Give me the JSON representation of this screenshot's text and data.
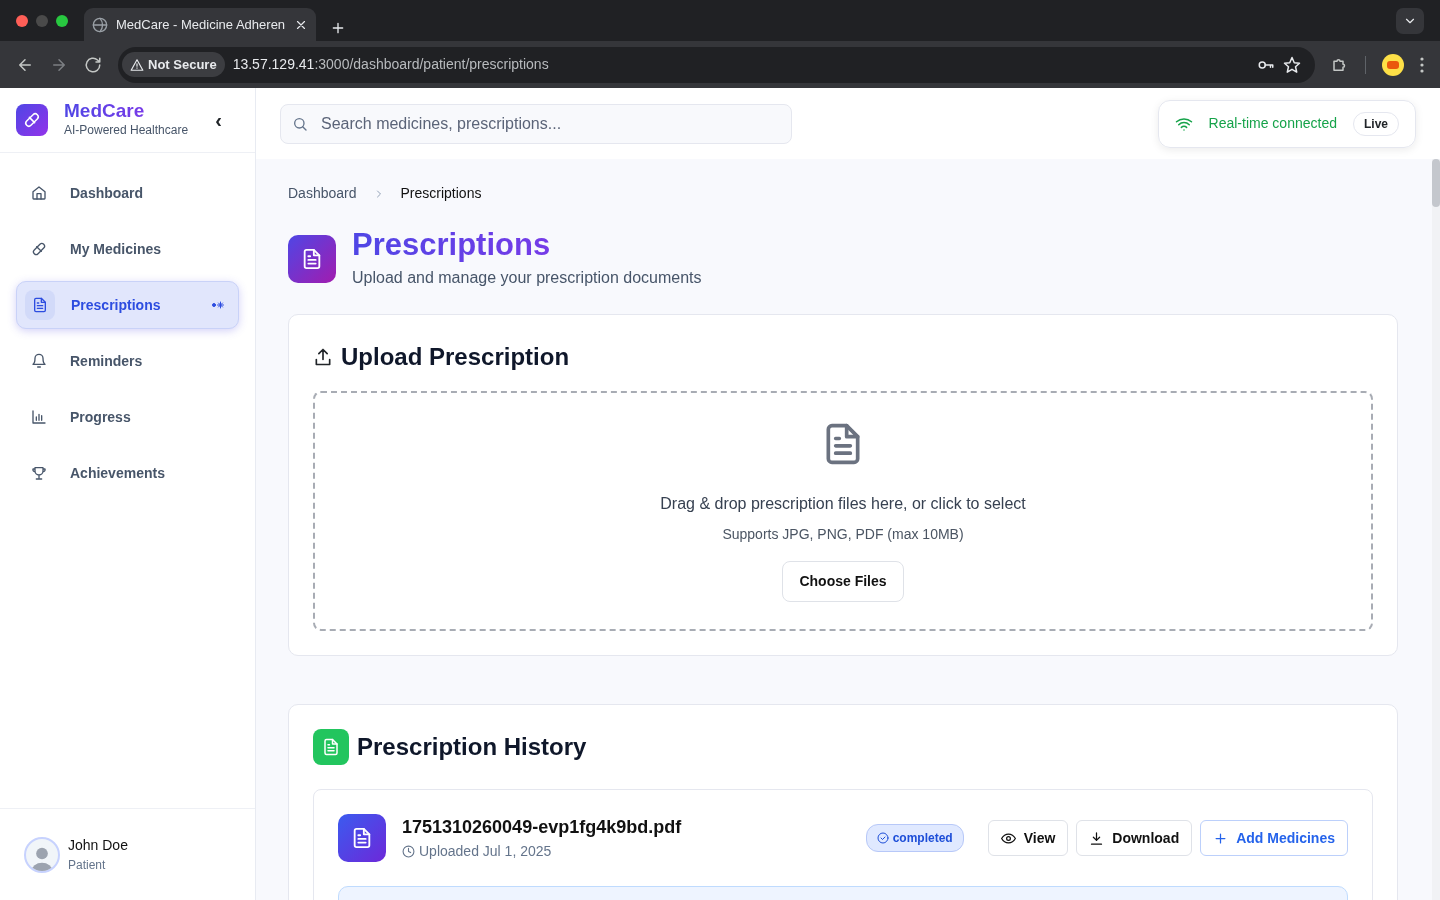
{
  "browser": {
    "tab_title": "MedCare - Medicine Adheren",
    "security": "Not Secure",
    "url_host": "13.57.129.41",
    "url_path": ":3000/dashboard/patient/prescriptions"
  },
  "sidebar": {
    "brand": "MedCare",
    "tagline": "AI-Powered Healthcare",
    "collapse": "‹",
    "items": [
      {
        "label": "Dashboard",
        "selected": false
      },
      {
        "label": "My Medicines",
        "selected": false
      },
      {
        "label": "Prescriptions",
        "selected": true
      },
      {
        "label": "Reminders",
        "selected": false
      },
      {
        "label": "Progress",
        "selected": false
      },
      {
        "label": "Achievements",
        "selected": false
      }
    ],
    "user": {
      "name": "John Doe",
      "role": "Patient"
    }
  },
  "topbar": {
    "search": {
      "placeholder": "Search medicines, prescriptions..."
    },
    "connection": {
      "text": "Real-time connected",
      "badge": "Live",
      "connected": true
    }
  },
  "breadcrumb": [
    "Dashboard",
    "Prescriptions"
  ],
  "header": {
    "title": "Prescriptions",
    "subtitle": "Upload and manage your prescription documents"
  },
  "upload": {
    "title": "Upload Prescription",
    "dropzone_text": "Drag & drop prescription files here, or click to select",
    "hint": "Supports JPG, PNG, PDF (max 10MB)",
    "button": "Choose Files"
  },
  "history": {
    "title": "Prescription History",
    "items": [
      {
        "filename": "1751310260049-evp1fg4k9bd.pdf",
        "uploaded": "Uploaded Jul 1, 2025",
        "status": "completed",
        "actions": [
          "View",
          "Download",
          "Add Medicines"
        ]
      }
    ]
  }
}
